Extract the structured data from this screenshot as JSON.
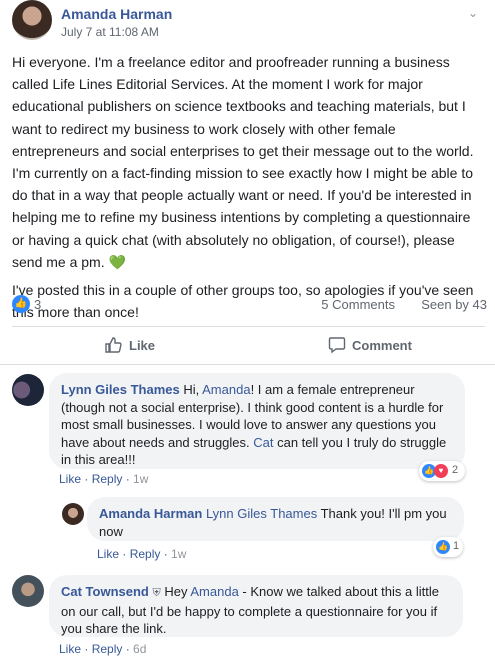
{
  "post": {
    "author": "Amanda Harman",
    "timestamp": "July 7 at 11:08 AM",
    "paragraph1": "Hi everyone. I'm a freelance editor and proofreader running a business called Life Lines Editorial Services. At the moment I work for major educational publishers on science textbooks and teaching materials, but I want to redirect my business to work closely with other female entrepreneurs and social enterprises to get their message out to the world. I'm currently on a fact-finding mission to see exactly how I might be able to do that in a way that people actually want or need. If you'd be interested in helping me to refine my business intentions by completing a questionnaire or having a quick chat (with absolutely no obligation, of course!), please send me a pm.",
    "emoji": "💚",
    "paragraph2": "I've posted this in a couple of other groups too, so apologies if you've seen this more than once!",
    "reaction_count": "3",
    "comments_count": "5 Comments",
    "seen_by": "Seen by 43"
  },
  "actions": {
    "like_label": "Like",
    "comment_label": "Comment"
  },
  "comments": [
    {
      "author": "Lynn Giles Thames",
      "text_before": " Hi, ",
      "mention": "Amanda",
      "text_middle": "! I am a female entrepreneur (though not a social enterprise). I think good content is a hurdle for most small businesses. I would love to answer any questions you have about needs and struggles. ",
      "mention2": "Cat",
      "text_after": " can tell you I truly do struggle in this area!!!",
      "like": "Like",
      "sep": " · ",
      "reply": "Reply",
      "time": "1w",
      "reactions": "2"
    },
    {
      "author": "Amanda Harman",
      "mention": "Lynn Giles Thames",
      "text": " Thank you! I'll pm you now",
      "like": "Like",
      "sep": " · ",
      "reply": "Reply",
      "time": "1w",
      "reactions": "1"
    },
    {
      "author": "Cat Townsend",
      "text_before": " Hey ",
      "mention": "Amanda",
      "text": " - Know we talked about this a little on our call, but I'd be happy to complete a questionnaire for you if you share the link.",
      "like": "Like",
      "sep": " · ",
      "reply": "Reply",
      "time": "6d"
    }
  ],
  "colors": {
    "link": "#385898",
    "like_blue": "#2d88ff",
    "love_red": "#f33e58",
    "bubble": "#f2f3f5"
  }
}
